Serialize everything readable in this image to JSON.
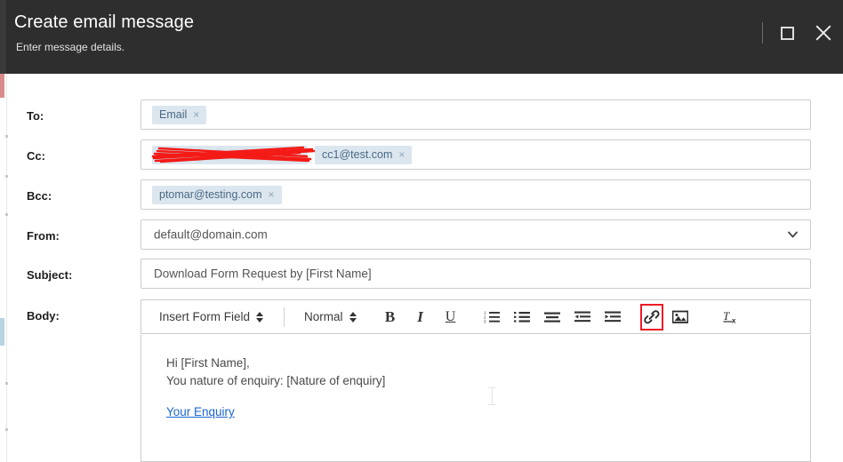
{
  "window": {
    "title": "Create email message",
    "subtitle": "Enter message details.",
    "controls": {
      "divider": "|",
      "maximize": "maximize-restore",
      "close": "close"
    }
  },
  "colors": {
    "header_bg": "#2e2e2e",
    "chip_bg": "#dbe6ef",
    "chip_text": "#4a6a85",
    "link": "#1a66d0",
    "highlight_box": "#ee1c25",
    "gutter_pink": "#d98b8b",
    "gutter_blue": "#b9d4e3"
  },
  "form": {
    "fields": [
      {
        "label": "To:",
        "type": "chips",
        "chips": [
          {
            "text": "Email",
            "remove": "×",
            "redacted": false
          }
        ]
      },
      {
        "label": "Cc:",
        "type": "chips",
        "chips": [
          {
            "text": "person@redacted.com",
            "remove": "×",
            "redacted": true
          },
          {
            "text": "cc1@test.com",
            "remove": "×",
            "redacted": false
          }
        ]
      },
      {
        "label": "Bcc:",
        "type": "chips",
        "chips": [
          {
            "text": "ptomar@testing.com",
            "remove": "×",
            "redacted": false
          }
        ]
      },
      {
        "label": "From:",
        "type": "select",
        "value": "default@domain.com"
      },
      {
        "label": "Subject:",
        "type": "text",
        "value": "Download Form Request by [First Name]"
      },
      {
        "label": "Body:",
        "type": "richtext"
      }
    ]
  },
  "editor": {
    "toolbar": {
      "insert_form_field": "Insert Form Field",
      "paragraph_style": "Normal",
      "bold": "B",
      "italic": "I",
      "underline": "U",
      "ordered_list": "ordered-list",
      "unordered_list": "unordered-list",
      "align": "align-left",
      "outdent": "outdent",
      "indent": "indent",
      "link": "link",
      "image": "image",
      "clear_format": "Tx"
    },
    "content": {
      "line1": "Hi [First Name],",
      "line2": "You nature of enquiry: [Nature of enquiry]",
      "link_text": "Your Enquiry "
    }
  }
}
